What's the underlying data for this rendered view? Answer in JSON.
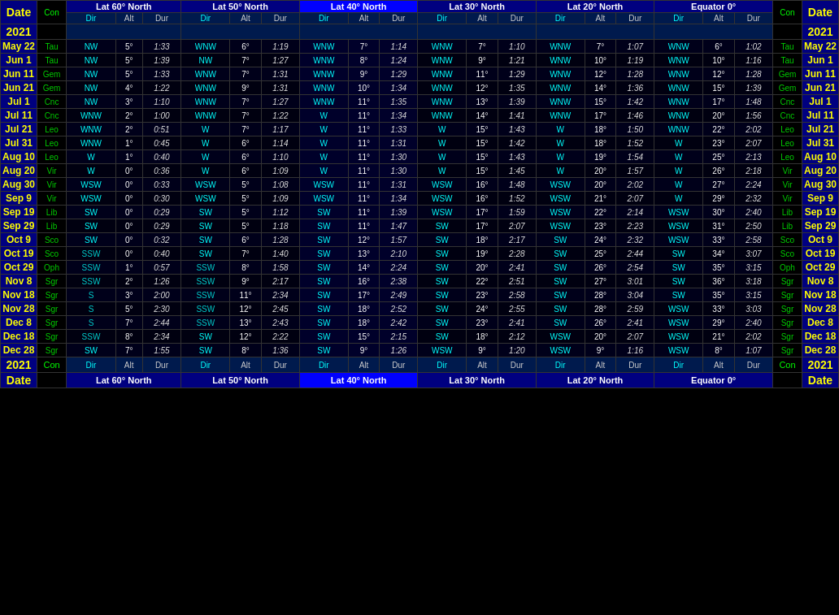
{
  "title": "Lat 400 North",
  "headers": {
    "date": "Date",
    "con": "Con",
    "lat60": "Lat 60° North",
    "lat50": "Lat 50° North",
    "lat40": "Lat 40° North",
    "lat30": "Lat 30° North",
    "lat20": "Lat 20° North",
    "equator": "Equator 0°"
  },
  "subheaders": [
    "Dir",
    "Alt",
    "Dur"
  ],
  "year": "2021",
  "rows": [
    {
      "date": "May 22",
      "con": "Tau",
      "l60": {
        "dir": "NW",
        "alt": "5°",
        "dur": "1:33"
      },
      "l50": {
        "dir": "WNW",
        "alt": "6°",
        "dur": "1:19"
      },
      "l40": {
        "dir": "WNW",
        "alt": "7°",
        "dur": "1:14"
      },
      "l30": {
        "dir": "WNW",
        "alt": "7°",
        "dur": "1:10"
      },
      "l20": {
        "dir": "WNW",
        "alt": "7°",
        "dur": "1:07"
      },
      "eq": {
        "dir": "WNW",
        "alt": "6°",
        "dur": "1:02"
      }
    },
    {
      "date": "Jun 1",
      "con": "Tau",
      "l60": {
        "dir": "NW",
        "alt": "5°",
        "dur": "1:39"
      },
      "l50": {
        "dir": "NW",
        "alt": "7°",
        "dur": "1:27"
      },
      "l40": {
        "dir": "WNW",
        "alt": "8°",
        "dur": "1:24"
      },
      "l30": {
        "dir": "WNW",
        "alt": "9°",
        "dur": "1:21"
      },
      "l20": {
        "dir": "WNW",
        "alt": "10°",
        "dur": "1:19"
      },
      "eq": {
        "dir": "WNW",
        "alt": "10°",
        "dur": "1:16"
      }
    },
    {
      "date": "Jun 11",
      "con": "Gem",
      "l60": {
        "dir": "NW",
        "alt": "5°",
        "dur": "1:33"
      },
      "l50": {
        "dir": "WNW",
        "alt": "7°",
        "dur": "1:31"
      },
      "l40": {
        "dir": "WNW",
        "alt": "9°",
        "dur": "1:29"
      },
      "l30": {
        "dir": "WNW",
        "alt": "11°",
        "dur": "1:29"
      },
      "l20": {
        "dir": "WNW",
        "alt": "12°",
        "dur": "1:28"
      },
      "eq": {
        "dir": "WNW",
        "alt": "12°",
        "dur": "1:28"
      }
    },
    {
      "date": "Jun 21",
      "con": "Gem",
      "l60": {
        "dir": "NW",
        "alt": "4°",
        "dur": "1:22"
      },
      "l50": {
        "dir": "WNW",
        "alt": "9°",
        "dur": "1:31"
      },
      "l40": {
        "dir": "WNW",
        "alt": "10°",
        "dur": "1:34"
      },
      "l30": {
        "dir": "WNW",
        "alt": "12°",
        "dur": "1:35"
      },
      "l20": {
        "dir": "WNW",
        "alt": "14°",
        "dur": "1:36"
      },
      "eq": {
        "dir": "WNW",
        "alt": "15°",
        "dur": "1:39"
      }
    },
    {
      "date": "Jul 1",
      "con": "Cnc",
      "l60": {
        "dir": "NW",
        "alt": "3°",
        "dur": "1:10"
      },
      "l50": {
        "dir": "WNW",
        "alt": "7°",
        "dur": "1:27"
      },
      "l40": {
        "dir": "WNW",
        "alt": "11°",
        "dur": "1:35"
      },
      "l30": {
        "dir": "WNW",
        "alt": "13°",
        "dur": "1:39"
      },
      "l20": {
        "dir": "WNW",
        "alt": "15°",
        "dur": "1:42"
      },
      "eq": {
        "dir": "WNW",
        "alt": "17°",
        "dur": "1:48"
      }
    },
    {
      "date": "Jul 11",
      "con": "Cnc",
      "l60": {
        "dir": "WNW",
        "alt": "2°",
        "dur": "1:00"
      },
      "l50": {
        "dir": "WNW",
        "alt": "7°",
        "dur": "1:22"
      },
      "l40": {
        "dir": "W",
        "alt": "11°",
        "dur": "1:34"
      },
      "l30": {
        "dir": "WNW",
        "alt": "14°",
        "dur": "1:41"
      },
      "l20": {
        "dir": "WNW",
        "alt": "17°",
        "dur": "1:46"
      },
      "eq": {
        "dir": "WNW",
        "alt": "20°",
        "dur": "1:56"
      }
    },
    {
      "date": "Jul 21",
      "con": "Leo",
      "l60": {
        "dir": "WNW",
        "alt": "2°",
        "dur": "0:51"
      },
      "l50": {
        "dir": "W",
        "alt": "7°",
        "dur": "1:17"
      },
      "l40": {
        "dir": "W",
        "alt": "11°",
        "dur": "1:33"
      },
      "l30": {
        "dir": "W",
        "alt": "15°",
        "dur": "1:43"
      },
      "l20": {
        "dir": "W",
        "alt": "18°",
        "dur": "1:50"
      },
      "eq": {
        "dir": "WNW",
        "alt": "22°",
        "dur": "2:02"
      }
    },
    {
      "date": "Jul 31",
      "con": "Leo",
      "l60": {
        "dir": "WNW",
        "alt": "1°",
        "dur": "0:45"
      },
      "l50": {
        "dir": "W",
        "alt": "6°",
        "dur": "1:14"
      },
      "l40": {
        "dir": "W",
        "alt": "11°",
        "dur": "1:31"
      },
      "l30": {
        "dir": "W",
        "alt": "15°",
        "dur": "1:42"
      },
      "l20": {
        "dir": "W",
        "alt": "18°",
        "dur": "1:52"
      },
      "eq": {
        "dir": "W",
        "alt": "23°",
        "dur": "2:07"
      }
    },
    {
      "date": "Aug 10",
      "con": "Leo",
      "l60": {
        "dir": "W",
        "alt": "1°",
        "dur": "0:40"
      },
      "l50": {
        "dir": "W",
        "alt": "6°",
        "dur": "1:10"
      },
      "l40": {
        "dir": "W",
        "alt": "11°",
        "dur": "1:30"
      },
      "l30": {
        "dir": "W",
        "alt": "15°",
        "dur": "1:43"
      },
      "l20": {
        "dir": "W",
        "alt": "19°",
        "dur": "1:54"
      },
      "eq": {
        "dir": "W",
        "alt": "25°",
        "dur": "2:13"
      }
    },
    {
      "date": "Aug 20",
      "con": "Vir",
      "l60": {
        "dir": "W",
        "alt": "0°",
        "dur": "0:36"
      },
      "l50": {
        "dir": "W",
        "alt": "6°",
        "dur": "1:09"
      },
      "l40": {
        "dir": "W",
        "alt": "11°",
        "dur": "1:30"
      },
      "l30": {
        "dir": "W",
        "alt": "15°",
        "dur": "1:45"
      },
      "l20": {
        "dir": "W",
        "alt": "20°",
        "dur": "1:57"
      },
      "eq": {
        "dir": "W",
        "alt": "26°",
        "dur": "2:18"
      }
    },
    {
      "date": "Aug 30",
      "con": "Vir",
      "l60": {
        "dir": "WSW",
        "alt": "0°",
        "dur": "0:33"
      },
      "l50": {
        "dir": "WSW",
        "alt": "5°",
        "dur": "1:08"
      },
      "l40": {
        "dir": "WSW",
        "alt": "11°",
        "dur": "1:31"
      },
      "l30": {
        "dir": "WSW",
        "alt": "16°",
        "dur": "1:48"
      },
      "l20": {
        "dir": "WSW",
        "alt": "20°",
        "dur": "2:02"
      },
      "eq": {
        "dir": "W",
        "alt": "27°",
        "dur": "2:24"
      }
    },
    {
      "date": "Sep 9",
      "con": "Vir",
      "l60": {
        "dir": "WSW",
        "alt": "0°",
        "dur": "0:30"
      },
      "l50": {
        "dir": "WSW",
        "alt": "5°",
        "dur": "1:09"
      },
      "l40": {
        "dir": "WSW",
        "alt": "11°",
        "dur": "1:34"
      },
      "l30": {
        "dir": "WSW",
        "alt": "16°",
        "dur": "1:52"
      },
      "l20": {
        "dir": "WSW",
        "alt": "21°",
        "dur": "2:07"
      },
      "eq": {
        "dir": "W",
        "alt": "29°",
        "dur": "2:32"
      }
    },
    {
      "date": "Sep 19",
      "con": "Lib",
      "l60": {
        "dir": "SW",
        "alt": "0°",
        "dur": "0:29"
      },
      "l50": {
        "dir": "SW",
        "alt": "5°",
        "dur": "1:12"
      },
      "l40": {
        "dir": "SW",
        "alt": "11°",
        "dur": "1:39"
      },
      "l30": {
        "dir": "WSW",
        "alt": "17°",
        "dur": "1:59"
      },
      "l20": {
        "dir": "WSW",
        "alt": "22°",
        "dur": "2:14"
      },
      "eq": {
        "dir": "WSW",
        "alt": "30°",
        "dur": "2:40"
      }
    },
    {
      "date": "Sep 29",
      "con": "Lib",
      "l60": {
        "dir": "SW",
        "alt": "0°",
        "dur": "0:29"
      },
      "l50": {
        "dir": "SW",
        "alt": "5°",
        "dur": "1:18"
      },
      "l40": {
        "dir": "SW",
        "alt": "11°",
        "dur": "1:47"
      },
      "l30": {
        "dir": "SW",
        "alt": "17°",
        "dur": "2:07"
      },
      "l20": {
        "dir": "WSW",
        "alt": "23°",
        "dur": "2:23"
      },
      "eq": {
        "dir": "WSW",
        "alt": "31°",
        "dur": "2:50"
      }
    },
    {
      "date": "Oct 9",
      "con": "Sco",
      "l60": {
        "dir": "SW",
        "alt": "0°",
        "dur": "0:32"
      },
      "l50": {
        "dir": "SW",
        "alt": "6°",
        "dur": "1:28"
      },
      "l40": {
        "dir": "SW",
        "alt": "12°",
        "dur": "1:57"
      },
      "l30": {
        "dir": "SW",
        "alt": "18°",
        "dur": "2:17"
      },
      "l20": {
        "dir": "SW",
        "alt": "24°",
        "dur": "2:32"
      },
      "eq": {
        "dir": "WSW",
        "alt": "33°",
        "dur": "2:58"
      }
    },
    {
      "date": "Oct 19",
      "con": "Sco",
      "l60": {
        "dir": "SSW",
        "alt": "0°",
        "dur": "0:40"
      },
      "l50": {
        "dir": "SW",
        "alt": "7°",
        "dur": "1:40"
      },
      "l40": {
        "dir": "SW",
        "alt": "13°",
        "dur": "2:10"
      },
      "l30": {
        "dir": "SW",
        "alt": "19°",
        "dur": "2:28"
      },
      "l20": {
        "dir": "SW",
        "alt": "25°",
        "dur": "2:44"
      },
      "eq": {
        "dir": "SW",
        "alt": "34°",
        "dur": "3:07"
      }
    },
    {
      "date": "Oct 29",
      "con": "Oph",
      "l60": {
        "dir": "SSW",
        "alt": "1°",
        "dur": "0:57"
      },
      "l50": {
        "dir": "SSW",
        "alt": "8°",
        "dur": "1:58"
      },
      "l40": {
        "dir": "SW",
        "alt": "14°",
        "dur": "2:24"
      },
      "l30": {
        "dir": "SW",
        "alt": "20°",
        "dur": "2:41"
      },
      "l20": {
        "dir": "SW",
        "alt": "26°",
        "dur": "2:54"
      },
      "eq": {
        "dir": "SW",
        "alt": "35°",
        "dur": "3:15"
      }
    },
    {
      "date": "Nov 8",
      "con": "Sgr",
      "l60": {
        "dir": "SSW",
        "alt": "2°",
        "dur": "1:26"
      },
      "l50": {
        "dir": "SSW",
        "alt": "9°",
        "dur": "2:17"
      },
      "l40": {
        "dir": "SW",
        "alt": "16°",
        "dur": "2:38"
      },
      "l30": {
        "dir": "SW",
        "alt": "22°",
        "dur": "2:51"
      },
      "l20": {
        "dir": "SW",
        "alt": "27°",
        "dur": "3:01"
      },
      "eq": {
        "dir": "SW",
        "alt": "36°",
        "dur": "3:18"
      }
    },
    {
      "date": "Nov 18",
      "con": "Sgr",
      "l60": {
        "dir": "S",
        "alt": "3°",
        "dur": "2:00"
      },
      "l50": {
        "dir": "SSW",
        "alt": "11°",
        "dur": "2:34"
      },
      "l40": {
        "dir": "SW",
        "alt": "17°",
        "dur": "2:49"
      },
      "l30": {
        "dir": "SW",
        "alt": "23°",
        "dur": "2:58"
      },
      "l20": {
        "dir": "SW",
        "alt": "28°",
        "dur": "3:04"
      },
      "eq": {
        "dir": "SW",
        "alt": "35°",
        "dur": "3:15"
      }
    },
    {
      "date": "Nov 28",
      "con": "Sgr",
      "l60": {
        "dir": "S",
        "alt": "5°",
        "dur": "2:30"
      },
      "l50": {
        "dir": "SSW",
        "alt": "12°",
        "dur": "2:45"
      },
      "l40": {
        "dir": "SW",
        "alt": "18°",
        "dur": "2:52"
      },
      "l30": {
        "dir": "SW",
        "alt": "24°",
        "dur": "2:55"
      },
      "l20": {
        "dir": "SW",
        "alt": "28°",
        "dur": "2:59"
      },
      "eq": {
        "dir": "WSW",
        "alt": "33°",
        "dur": "3:03"
      }
    },
    {
      "date": "Dec 8",
      "con": "Sgr",
      "l60": {
        "dir": "S",
        "alt": "7°",
        "dur": "2:44"
      },
      "l50": {
        "dir": "SSW",
        "alt": "13°",
        "dur": "2:43"
      },
      "l40": {
        "dir": "SW",
        "alt": "18°",
        "dur": "2:42"
      },
      "l30": {
        "dir": "SW",
        "alt": "23°",
        "dur": "2:41"
      },
      "l20": {
        "dir": "SW",
        "alt": "26°",
        "dur": "2:41"
      },
      "eq": {
        "dir": "WSW",
        "alt": "29°",
        "dur": "2:40"
      }
    },
    {
      "date": "Dec 18",
      "con": "Sgr",
      "l60": {
        "dir": "SSW",
        "alt": "8°",
        "dur": "2:34"
      },
      "l50": {
        "dir": "SW",
        "alt": "12°",
        "dur": "2:22"
      },
      "l40": {
        "dir": "SW",
        "alt": "15°",
        "dur": "2:15"
      },
      "l30": {
        "dir": "SW",
        "alt": "18°",
        "dur": "2:12"
      },
      "l20": {
        "dir": "WSW",
        "alt": "20°",
        "dur": "2:07"
      },
      "eq": {
        "dir": "WSW",
        "alt": "21°",
        "dur": "2:02"
      }
    },
    {
      "date": "Dec 28",
      "con": "Sgr",
      "l60": {
        "dir": "SW",
        "alt": "7°",
        "dur": "1:55"
      },
      "l50": {
        "dir": "SW",
        "alt": "8°",
        "dur": "1:36"
      },
      "l40": {
        "dir": "SW",
        "alt": "9°",
        "dur": "1:26"
      },
      "l30": {
        "dir": "WSW",
        "alt": "9°",
        "dur": "1:20"
      },
      "l20": {
        "dir": "WSW",
        "alt": "9°",
        "dur": "1:16"
      },
      "eq": {
        "dir": "WSW",
        "alt": "8°",
        "dur": "1:07"
      }
    }
  ]
}
